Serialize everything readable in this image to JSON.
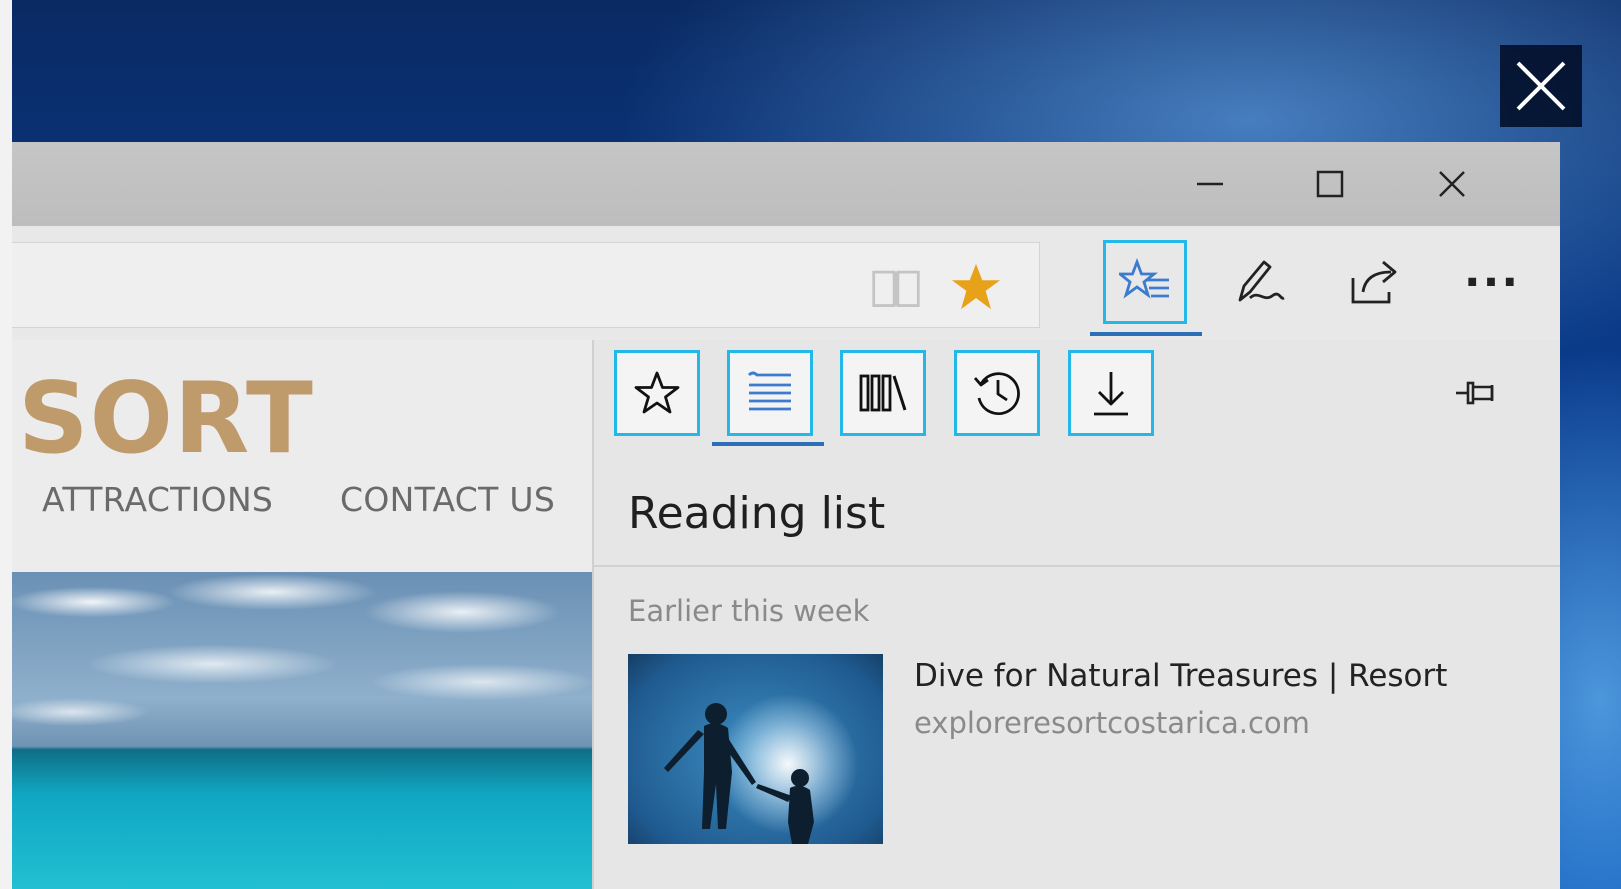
{
  "window": {
    "overlay_close": "close-icon",
    "title_buttons": [
      "minimize-icon",
      "maximize-icon",
      "close-icon"
    ]
  },
  "address_bar": {
    "icons": [
      "reading-view-icon",
      "favorite-star-icon"
    ],
    "star_color": "#e8a21a"
  },
  "toolbar": {
    "buttons": [
      "hub-icon",
      "web-note-icon",
      "share-icon",
      "more-icon"
    ],
    "more_label": "···",
    "active": "hub-icon"
  },
  "page": {
    "brand": "SORT",
    "nav": [
      "ATTRACTIONS",
      "CONTACT US"
    ]
  },
  "hub": {
    "tabs": [
      "favorites-icon",
      "reading-list-icon",
      "books-icon",
      "history-icon",
      "downloads-icon"
    ],
    "active_tab": "reading-list-icon",
    "title": "Reading list",
    "pin": "pin-icon",
    "section": "Earlier this week",
    "items": [
      {
        "title": "Dive for Natural Treasures | Resort",
        "url": "exploreresortcostarica.com"
      }
    ]
  },
  "colors": {
    "highlight": "#22b8ea",
    "accent_underline": "#2d6fb7",
    "brand": "#bf9a6a"
  }
}
